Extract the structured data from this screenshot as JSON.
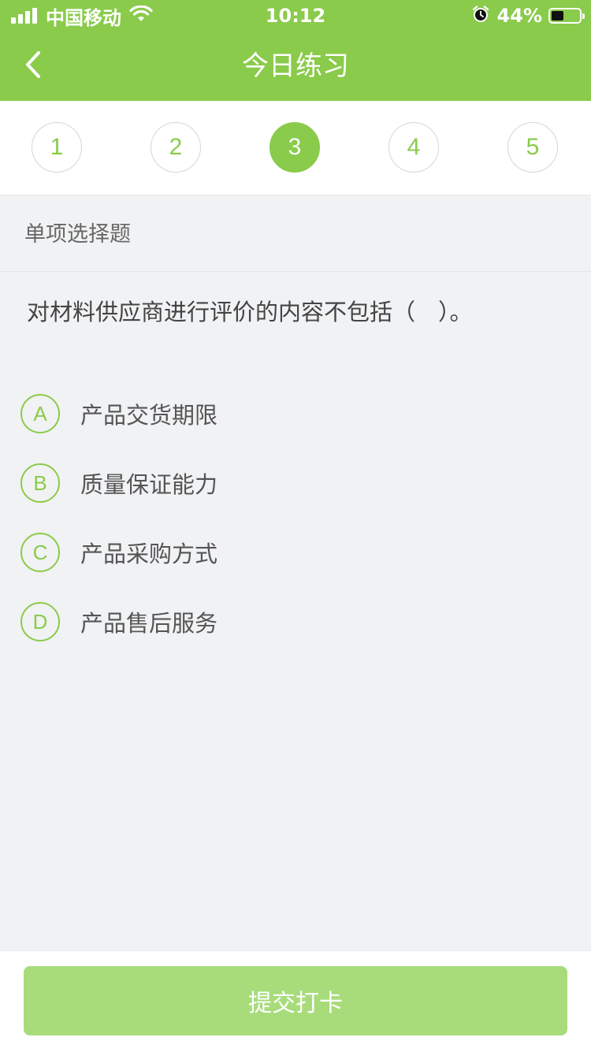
{
  "status_bar": {
    "carrier": "中国移动",
    "time": "10:12",
    "battery_percent": "44%",
    "battery_level": 0.44
  },
  "nav": {
    "title": "今日练习",
    "back_icon": "chevron-left-icon"
  },
  "steps": {
    "items": [
      "1",
      "2",
      "3",
      "4",
      "5"
    ],
    "active_index": 2
  },
  "question": {
    "type": "单项选择题",
    "text": "对材料供应商进行评价的内容不包括（　）。",
    "options": [
      {
        "letter": "A",
        "text": "产品交货期限"
      },
      {
        "letter": "B",
        "text": "质量保证能力"
      },
      {
        "letter": "C",
        "text": "产品采购方式"
      },
      {
        "letter": "D",
        "text": "产品售后服务"
      }
    ]
  },
  "footer": {
    "submit_label": "提交打卡"
  },
  "colors": {
    "accent": "#8acb4b",
    "button_disabled": "#a8dc7b",
    "background": "#f1f2f4"
  }
}
